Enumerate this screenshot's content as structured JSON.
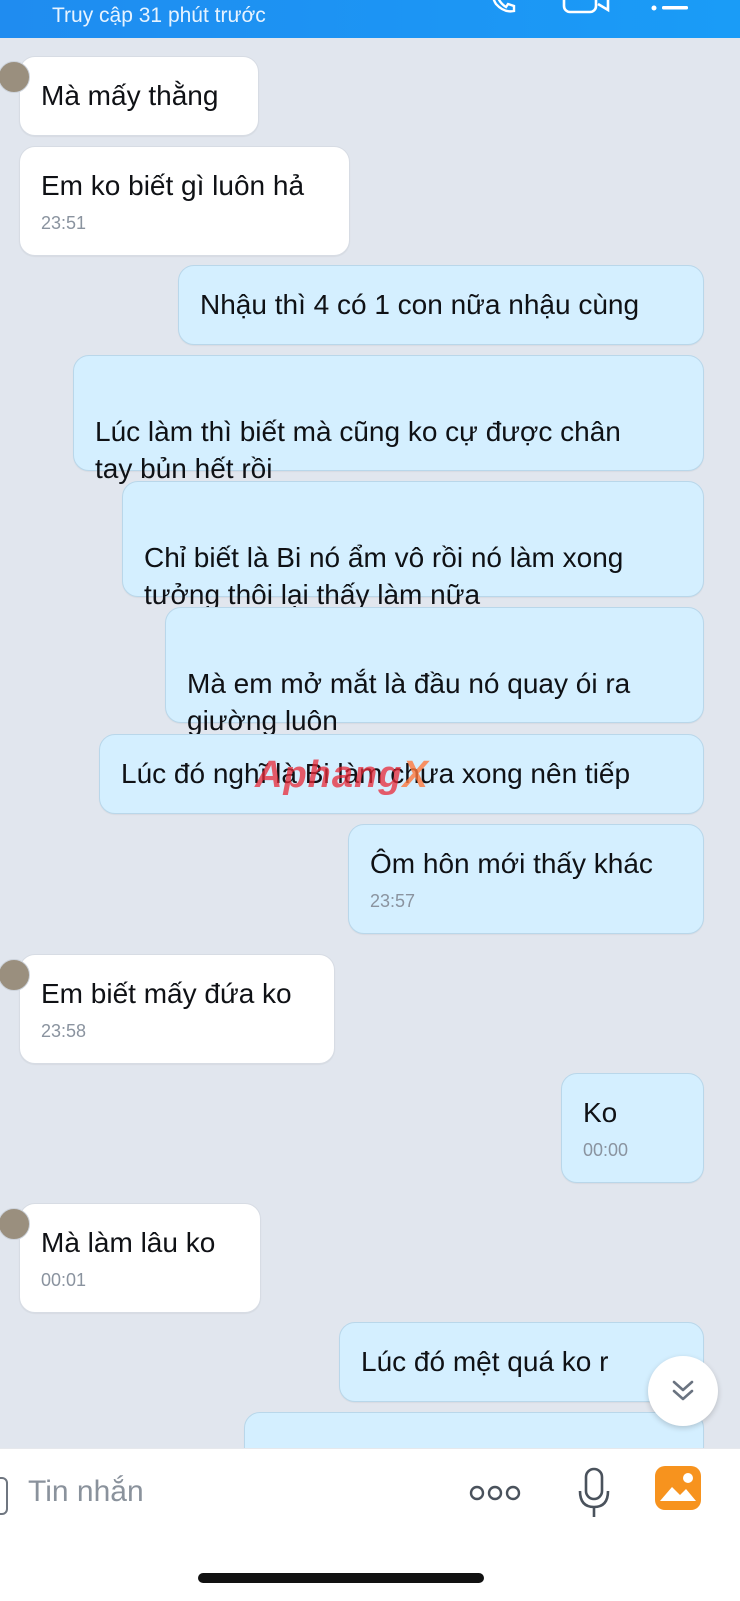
{
  "header": {
    "status": "Truy cập 31 phút trước"
  },
  "messages": [
    {
      "side": "in",
      "text": "Mà mấy thằng",
      "time": ""
    },
    {
      "side": "in",
      "text": "Em ko biết gì luôn hả",
      "time": "23:51"
    },
    {
      "side": "out",
      "text": "Nhậu thì 4 có 1 con nữa nhậu cùng",
      "time": ""
    },
    {
      "side": "out",
      "text": "Lúc làm thì biết mà cũng ko cự được chân\ntay bủn hết rồi",
      "time": ""
    },
    {
      "side": "out",
      "text": "Chỉ biết là Bi nó ẩm vô rồi nó làm xong\ntưởng thôi lại thấy làm nữa",
      "time": ""
    },
    {
      "side": "out",
      "text": "Mà em mở mắt là đầu nó quay ói ra\ngiường luôn",
      "time": ""
    },
    {
      "side": "out",
      "text": "Lúc đó nghĩ là Bi làm chưa xong nên tiếp",
      "time": ""
    },
    {
      "side": "out",
      "text": "Ôm hôn mới thấy khác",
      "time": "23:57"
    },
    {
      "side": "in",
      "text": "Em biết mấy đứa ko",
      "time": "23:58"
    },
    {
      "side": "out",
      "text": "Ko",
      "time": "00:00"
    },
    {
      "side": "in",
      "text": "Mà làm lâu ko",
      "time": "00:01"
    },
    {
      "side": "out",
      "text": "Lúc đó mệt quá ko r",
      "time": ""
    }
  ],
  "watermark": {
    "main": "Aphang",
    "accent": "X"
  },
  "input": {
    "placeholder": "Tin nhắn"
  },
  "icons": {
    "call": "phone-icon",
    "video": "video-camera-icon",
    "menu": "list-menu-icon",
    "more": "more-dots-icon",
    "mic": "microphone-icon",
    "image": "image-gallery-icon",
    "scroll": "double-chevron-down-icon"
  },
  "colors": {
    "header": "#1a8ff2",
    "incoming": "#ffffff",
    "outgoing": "#d4efff",
    "background": "#e1e6ee",
    "image_icon": "#f7931e"
  }
}
